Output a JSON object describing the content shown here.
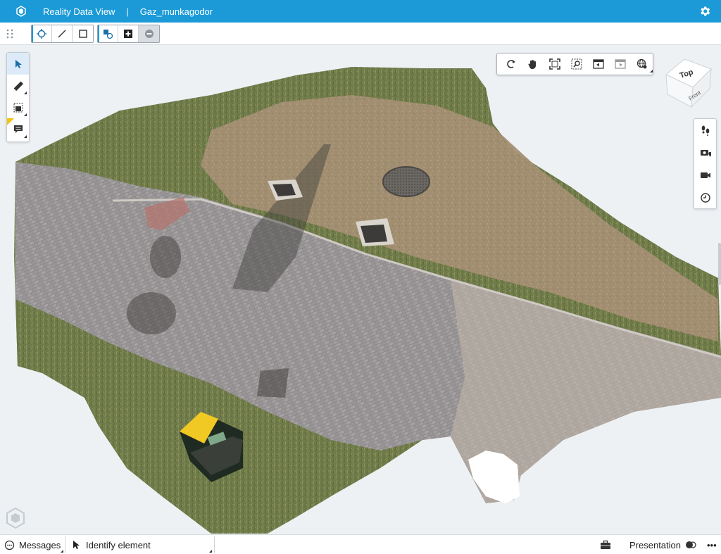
{
  "titlebar": {
    "app_title": "Reality Data View",
    "separator": "|",
    "project_name": "Gaz_munkagodor"
  },
  "toolbar": {
    "groups": [
      {
        "items": [
          "crosshair-point-icon",
          "line-icon",
          "rectangle-icon"
        ]
      },
      {
        "items": [
          "select-shapes-icon",
          "add-icon",
          "remove-icon"
        ]
      }
    ]
  },
  "view_cube": {
    "top_label": "Top",
    "front_label": "Front"
  },
  "statusbar": {
    "messages_label": "Messages",
    "tool_label": "Identify element",
    "presentation_label": "Presentation",
    "more_label": "•••"
  },
  "colors": {
    "accent": "#1b9ad7",
    "flag": "#f1c40f"
  }
}
